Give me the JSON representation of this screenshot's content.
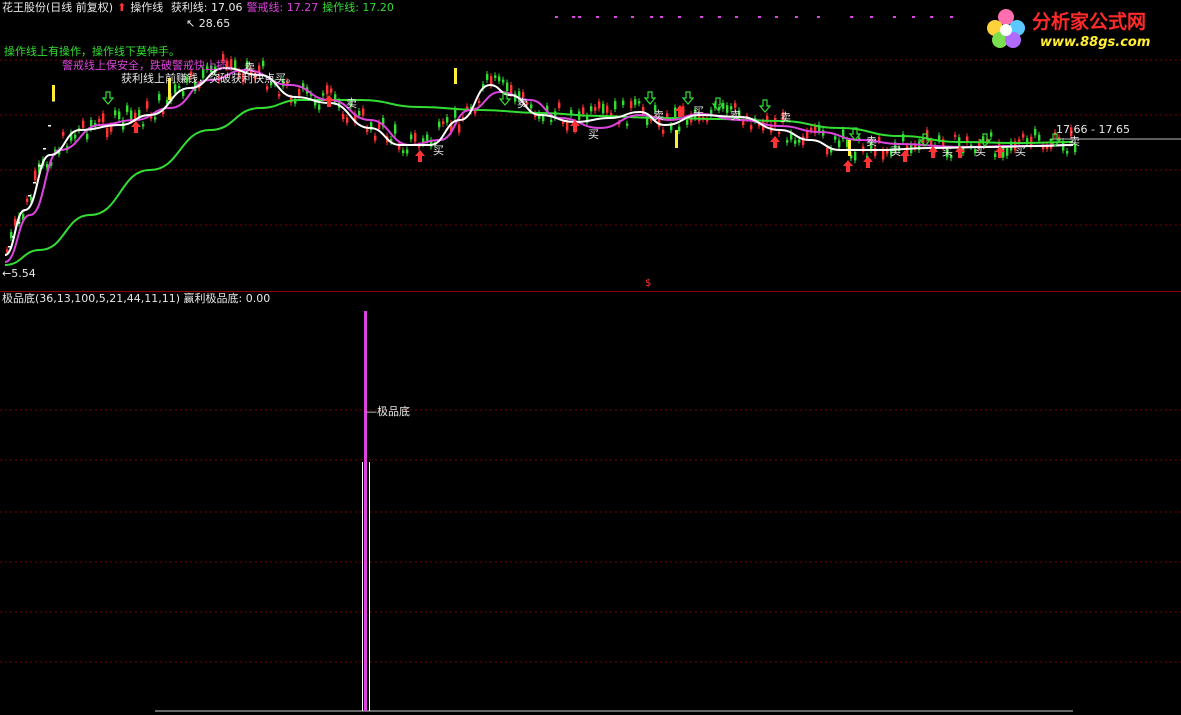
{
  "header": {
    "title": "花王股份(日线 前复权)",
    "op_line_label": "操作线",
    "profit_line": "获利线: 17.06",
    "warn_line": "警戒线: 17.27",
    "op_line_value": "操作线: 17.20"
  },
  "logo": {
    "name": "分析家公式网",
    "url_text": "www.88gs.com"
  },
  "main_chart": {
    "high_label": "28.65",
    "low_label": "5.54",
    "range_label": "17.66 - 17.65",
    "notes": {
      "op": "操作线上有操作，操作线下莫伸手。",
      "warn": "警戒线上保安全，跌破警戒快止损。",
      "profit": "获利线上前赚钱，突破获利快点买。"
    },
    "buy_text": "买",
    "sell_text": "卖",
    "dollar_marker": "$"
  },
  "sub_chart": {
    "indicator_title": "极品底(36,13,100,5,21,44,11,11)",
    "indicator_value": "赢利极品底: 0.00",
    "signal_label": "极品底"
  },
  "colors": {
    "profit": "#ffffff",
    "warn": "#dd44dd",
    "op": "#33dd33",
    "up": "#ff3333",
    "down": "#33dd33",
    "grid": "#7a0000"
  }
}
